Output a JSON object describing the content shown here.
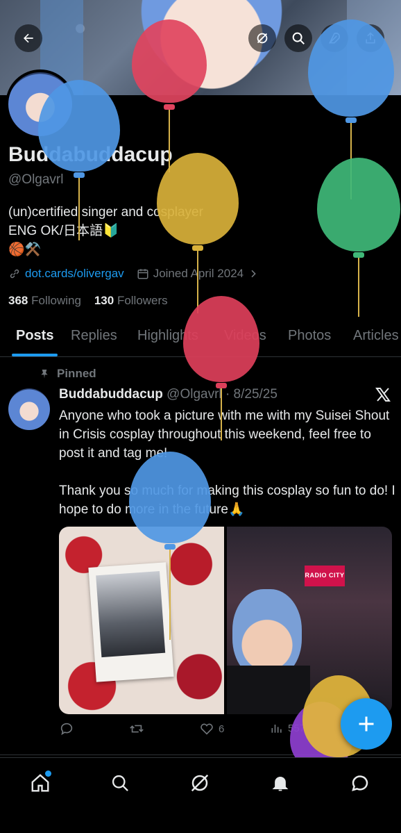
{
  "header": {
    "back_icon": "arrow-left-icon",
    "grok_icon": "grok-icon",
    "search_icon": "search-icon",
    "edit_icon": "feather-icon",
    "share_icon": "share-icon"
  },
  "profile": {
    "display_name": "Buddabuddacup",
    "handle": "@Olgavrl",
    "bio_line1": "(un)certified singer and cosplayer",
    "bio_line2": "ENG OK/日本語🔰",
    "bio_line3": "🏀⚒️",
    "link": "dot.cards/olivergav",
    "joined": "Joined April 2024",
    "following_count": "368",
    "following_label": "Following",
    "followers_count": "130",
    "followers_label": "Followers"
  },
  "tabs": [
    {
      "label": "Posts",
      "active": true
    },
    {
      "label": "Replies"
    },
    {
      "label": "Highlights"
    },
    {
      "label": "Videos"
    },
    {
      "label": "Photos"
    },
    {
      "label": "Articles"
    }
  ],
  "post": {
    "pinned_label": "Pinned",
    "author_name": "Buddabuddacup",
    "author_handle": "@Olgavrl",
    "separator": "·",
    "date": "8/25/25",
    "text_p1": "Anyone who took a picture with me with my Suisei Shout in Crisis cosplay throughout this weekend, feel free to post it and tag me!",
    "text_p2": "Thank you so much for making this cosplay so fun to do! I hope to do more in the future🙏",
    "sign_text": "RADIO CITY",
    "likes": "6",
    "views": "557"
  },
  "nav": [
    "home-icon",
    "search-icon",
    "grok-icon",
    "notifications-icon",
    "messages-icon"
  ],
  "colors": {
    "accent": "#1d9bf0",
    "muted": "#71767b",
    "text": "#e7e9ea",
    "background": "#000000"
  }
}
